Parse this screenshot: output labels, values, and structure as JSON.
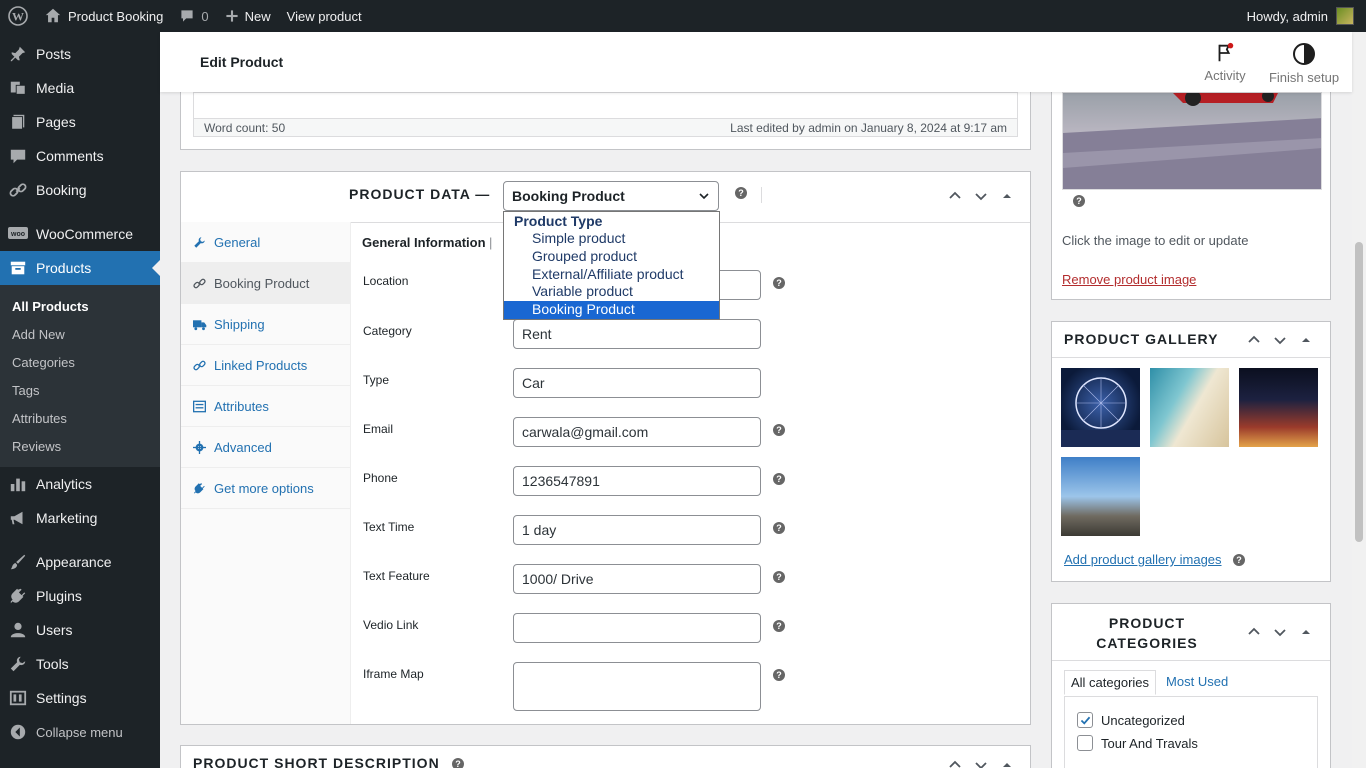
{
  "adminbar": {
    "site_name": "Product Booking",
    "comments_count": "0",
    "new_label": "New",
    "view_label": "View product",
    "howdy": "Howdy, admin"
  },
  "sidebar": {
    "posts": "Posts",
    "media": "Media",
    "pages": "Pages",
    "comments": "Comments",
    "booking": "Booking",
    "woocommerce": "WooCommerce",
    "products": "Products",
    "sub": {
      "all_products": "All Products",
      "add_new": "Add New",
      "categories": "Categories",
      "tags": "Tags",
      "attributes": "Attributes",
      "reviews": "Reviews"
    },
    "analytics": "Analytics",
    "marketing": "Marketing",
    "appearance": "Appearance",
    "plugins": "Plugins",
    "users": "Users",
    "tools": "Tools",
    "settings": "Settings",
    "collapse": "Collapse menu"
  },
  "header": {
    "title": "Edit Product",
    "activity": "Activity",
    "finish_setup": "Finish setup"
  },
  "editor": {
    "word_count": "Word count: 50",
    "last_edited": "Last edited by admin on January 8, 2024 at 9:17 am"
  },
  "product_data": {
    "label": "PRODUCT DATA —",
    "selected_type": "Booking Product",
    "dropdown": {
      "group": "Product Type",
      "options": [
        "Simple product",
        "Grouped product",
        "External/Affiliate product",
        "Variable product",
        "Booking Product"
      ]
    },
    "tabs": [
      "General",
      "Booking Product",
      "Shipping",
      "Linked Products",
      "Attributes",
      "Advanced",
      "Get more options"
    ],
    "panel_heading": "General Information",
    "panel_sep": "|",
    "fields": [
      {
        "label": "Location",
        "value": ""
      },
      {
        "label": "Category",
        "value": "Rent"
      },
      {
        "label": "Type",
        "value": "Car"
      },
      {
        "label": "Email",
        "value": "carwala@gmail.com"
      },
      {
        "label": "Phone",
        "value": "1236547891"
      },
      {
        "label": "Text Time",
        "value": "1 day"
      },
      {
        "label": "Text Feature",
        "value": "1000/ Drive"
      },
      {
        "label": "Vedio Link",
        "value": ""
      },
      {
        "label": "Iframe Map",
        "value": ""
      }
    ]
  },
  "short_description": {
    "title": "PRODUCT SHORT DESCRIPTION"
  },
  "product_image": {
    "hint": "Click the image to edit or update",
    "remove": "Remove product image"
  },
  "gallery": {
    "title": "PRODUCT GALLERY",
    "add_link": "Add product gallery images"
  },
  "categories": {
    "title_line1": "PRODUCT",
    "title_line2": "CATEGORIES",
    "tab_all": "All categories",
    "tab_most": "Most Used",
    "items": [
      {
        "label": "Uncategorized",
        "checked": true
      },
      {
        "label": "Tour And Travals",
        "checked": false
      }
    ]
  },
  "help_glyph": "?",
  "colors": {
    "accent": "#2271b1",
    "adminbar": "#1d2327",
    "dropdown_selected": "#1967d2",
    "danger_link": "#b32d2e"
  }
}
